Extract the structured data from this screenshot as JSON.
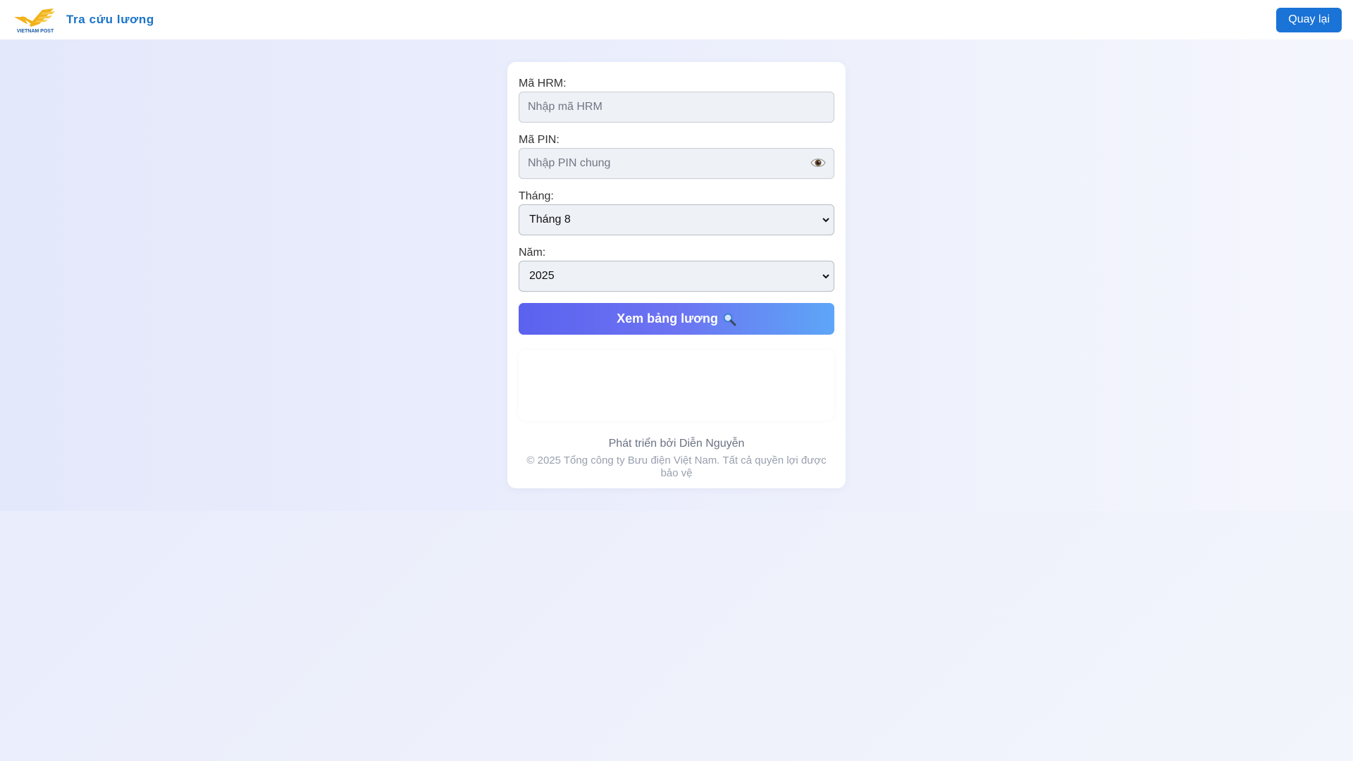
{
  "header": {
    "logo_text": "VIETNAM POST",
    "title": "Tra cứu lương",
    "back_label": "Quay lại"
  },
  "form": {
    "hrm": {
      "label": "Mã HRM:",
      "placeholder": "Nhập mã HRM",
      "value": ""
    },
    "pin": {
      "label": "Mã PIN:",
      "placeholder": "Nhập PIN chung",
      "value": ""
    },
    "month": {
      "label": "Tháng:",
      "selected": "Tháng 8"
    },
    "year": {
      "label": "Năm:",
      "selected": "2025"
    },
    "submit_label": "Xem bảng lương"
  },
  "footer": {
    "developer": "Phát triển bởi Diễn Nguyễn",
    "copyright": "© 2025 Tổng công ty Bưu điện Việt Nam. Tất cả quyền lợi được bảo vệ"
  },
  "colors": {
    "accent": "#1a73d6",
    "button_gradient_start": "#5b62ef",
    "button_gradient_end": "#5da6f7",
    "logo_yellow": "#f2b21c",
    "logo_blue": "#1a5aa8"
  },
  "icons": [
    "vietnam-post-logo",
    "eye-icon",
    "magnifier-icon",
    "chevron-down-icon"
  ]
}
